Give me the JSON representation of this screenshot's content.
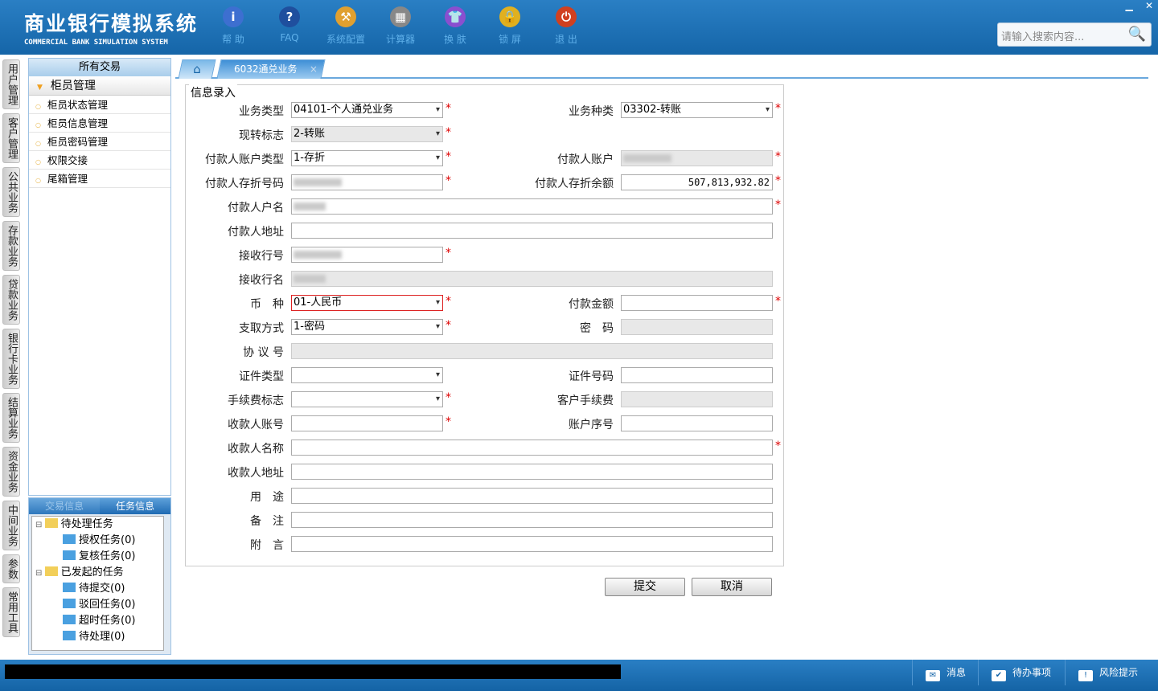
{
  "app": {
    "title_cn": "商业银行模拟系统",
    "title_en": "COMMERCIAL BANK SIMULATION SYSTEM"
  },
  "toolbar": [
    {
      "label": "帮 助",
      "icon": "info-icon",
      "color": "#3d6fd0",
      "glyph": "i"
    },
    {
      "label": "FAQ",
      "icon": "question-icon",
      "color": "#1f4f9e",
      "glyph": "?"
    },
    {
      "label": "系统配置",
      "icon": "toolbox-icon",
      "color": "#e0a030",
      "glyph": "⚒"
    },
    {
      "label": "计算器",
      "icon": "calculator-icon",
      "color": "#888888",
      "glyph": "▦"
    },
    {
      "label": "换 肤",
      "icon": "shirt-icon",
      "color": "#8a4fcf",
      "glyph": "👕"
    },
    {
      "label": "锁 屏",
      "icon": "lock-icon",
      "color": "#e0b020",
      "glyph": "🔒"
    },
    {
      "label": "退 出",
      "icon": "power-icon",
      "color": "#d04020",
      "glyph": "⏻"
    }
  ],
  "search": {
    "placeholder": "请输入搜索内容..."
  },
  "vtabs": [
    "用户管理",
    "客户管理",
    "公共业务",
    "存款业务",
    "贷款业务",
    "银行卡业务",
    "结算业务",
    "资金业务",
    "中间业务",
    "参数",
    "常用工具"
  ],
  "sidebar": {
    "header": "所有交易",
    "group": "柜员管理",
    "items": [
      "柜员状态管理",
      "柜员信息管理",
      "柜员密码管理",
      "权限交接",
      "尾箱管理"
    ]
  },
  "tasks": {
    "tabs": [
      "交易信息",
      "任务信息"
    ],
    "tree": [
      {
        "label": "待处理任务",
        "level": 0
      },
      {
        "label": "授权任务(0)",
        "level": 1
      },
      {
        "label": "复核任务(0)",
        "level": 1
      },
      {
        "label": "已发起的任务",
        "level": 0
      },
      {
        "label": "待提交(0)",
        "level": 1
      },
      {
        "label": "驳回任务(0)",
        "level": 1
      },
      {
        "label": "超时任务(0)",
        "level": 1
      },
      {
        "label": "待处理(0)",
        "level": 1
      }
    ]
  },
  "tab": {
    "label": "6032通兑业务",
    "close": "×"
  },
  "form": {
    "legend": "信息录入",
    "rows": [
      [
        {
          "label": "业务类型",
          "value": "04101-个人通兑业务",
          "type": "select",
          "req": true
        },
        {
          "label": "业务种类",
          "value": "03302-转账",
          "type": "select",
          "req": true
        }
      ],
      [
        {
          "label": "现转标志",
          "value": "2-转账",
          "type": "select",
          "dis": true,
          "req": true
        }
      ],
      [
        {
          "label": "付款人账户类型",
          "value": "1-存折",
          "type": "select",
          "req": true
        },
        {
          "label": "付款人账户",
          "value": "",
          "blur": true,
          "dis": true,
          "req": true
        }
      ],
      [
        {
          "label": "付款人存折号码",
          "value": "",
          "blur": true,
          "req": true
        },
        {
          "label": "付款人存折余额",
          "value": "507,813,932.82",
          "num": true,
          "req": true
        }
      ],
      [
        {
          "label": "付款人户名",
          "value": "",
          "blur": true,
          "full": true,
          "req": true
        }
      ],
      [
        {
          "label": "付款人地址",
          "value": "",
          "full": true
        }
      ],
      [
        {
          "label": "接收行号",
          "value": "",
          "blur": true,
          "req": true
        }
      ],
      [
        {
          "label": "接收行名",
          "value": "",
          "blur": true,
          "full": true,
          "dis": true
        }
      ],
      [
        {
          "label": "币　种",
          "value": "01-人民币",
          "type": "select",
          "req": true,
          "red": true
        },
        {
          "label": "付款金额",
          "value": "",
          "req": true
        }
      ],
      [
        {
          "label": "支取方式",
          "value": "1-密码",
          "type": "select",
          "req": true
        },
        {
          "label": "密　码",
          "value": "",
          "dis": true
        }
      ],
      [
        {
          "label": "协 议 号",
          "value": "",
          "full": true,
          "dis": true
        }
      ],
      [
        {
          "label": "证件类型",
          "value": "",
          "type": "select"
        },
        {
          "label": "证件号码",
          "value": ""
        }
      ],
      [
        {
          "label": "手续费标志",
          "value": "",
          "type": "select",
          "req": true
        },
        {
          "label": "客户手续费",
          "value": "",
          "dis": true
        }
      ],
      [
        {
          "label": "收款人账号",
          "value": "",
          "req": true
        },
        {
          "label": "账户序号",
          "value": ""
        }
      ],
      [
        {
          "label": "收款人名称",
          "value": "",
          "full": true,
          "req": true
        }
      ],
      [
        {
          "label": "收款人地址",
          "value": "",
          "full": true
        }
      ],
      [
        {
          "label": "用　途",
          "value": "",
          "full": true
        }
      ],
      [
        {
          "label": "备　注",
          "value": "",
          "full": true
        }
      ],
      [
        {
          "label": "附　言",
          "value": "",
          "full": true
        }
      ]
    ],
    "submit": "提交",
    "cancel": "取消",
    "required_mark": "*"
  },
  "status": [
    {
      "label": "消息",
      "icon": "mail-icon",
      "glyph": "✉"
    },
    {
      "label": "待办事项",
      "icon": "checkbox-icon",
      "glyph": "✔"
    },
    {
      "label": "风险提示",
      "icon": "speech-alert-icon",
      "glyph": "!"
    }
  ]
}
